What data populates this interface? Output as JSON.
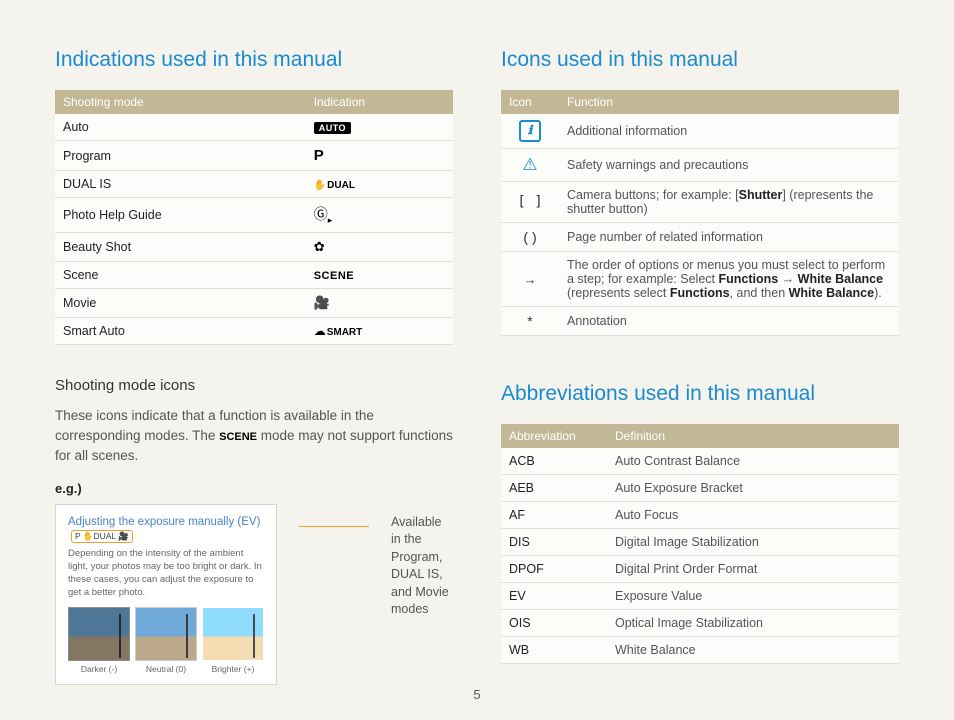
{
  "left": {
    "title": "Indications used in this manual",
    "table_headers": [
      "Shooting mode",
      "Indication"
    ],
    "rows": [
      "Auto",
      "Program",
      "DUAL IS",
      "Photo Help Guide",
      "Beauty Shot",
      "Scene",
      "Movie",
      "Smart Auto"
    ],
    "auto_label": "AUTO",
    "scene_label": "SCENE",
    "smart_label": "SMART",
    "dual_label": "DUAL",
    "subhead": "Shooting mode icons",
    "body_a": "These icons indicate that a function is available in the corresponding modes. The ",
    "body_b": " mode may not support functions for all scenes.",
    "eg": "e.g.)",
    "example": {
      "title": "Adjusting the exposure manually (EV)",
      "pill": "P ✋DUAL 🎥",
      "desc": "Depending on the intensity of the ambient light, your photos may be too bright or dark. In these cases, you can adjust the exposure to get a better photo.",
      "caps": [
        "Darker (-)",
        "Neutral (0)",
        "Brighter (+)"
      ]
    },
    "callout": "Available in the Program, DUAL IS, and Movie modes"
  },
  "right_icons": {
    "title": "Icons used in this manual",
    "headers": [
      "Icon",
      "Function"
    ],
    "r1": "Additional information",
    "r2": "Safety warnings and precautions",
    "r3a": "Camera buttons; for example: [",
    "r3b": "Shutter",
    "r3c": "] (represents the shutter button)",
    "r4": "Page number of related information",
    "r5a": "The order of options or menus you must select to perform a step; for example: Select ",
    "r5b": "Functions",
    "r5c": " → ",
    "r5d": "White Balance",
    "r5e": " (represents select ",
    "r5f": "Functions",
    "r5g": ", and then ",
    "r5h": "White Balance",
    "r5i": ").",
    "r6": "Annotation"
  },
  "right_abbrev": {
    "title": "Abbreviations used in this manual",
    "headers": [
      "Abbreviation",
      "Definition"
    ],
    "rows": [
      {
        "a": "ACB",
        "d": "Auto Contrast Balance"
      },
      {
        "a": "AEB",
        "d": "Auto Exposure Bracket"
      },
      {
        "a": "AF",
        "d": "Auto Focus"
      },
      {
        "a": "DIS",
        "d": "Digital Image Stabilization"
      },
      {
        "a": "DPOF",
        "d": "Digital Print Order Format"
      },
      {
        "a": "EV",
        "d": "Exposure Value"
      },
      {
        "a": "OIS",
        "d": "Optical Image Stabilization"
      },
      {
        "a": "WB",
        "d": "White Balance"
      }
    ]
  },
  "pagenum": "5"
}
